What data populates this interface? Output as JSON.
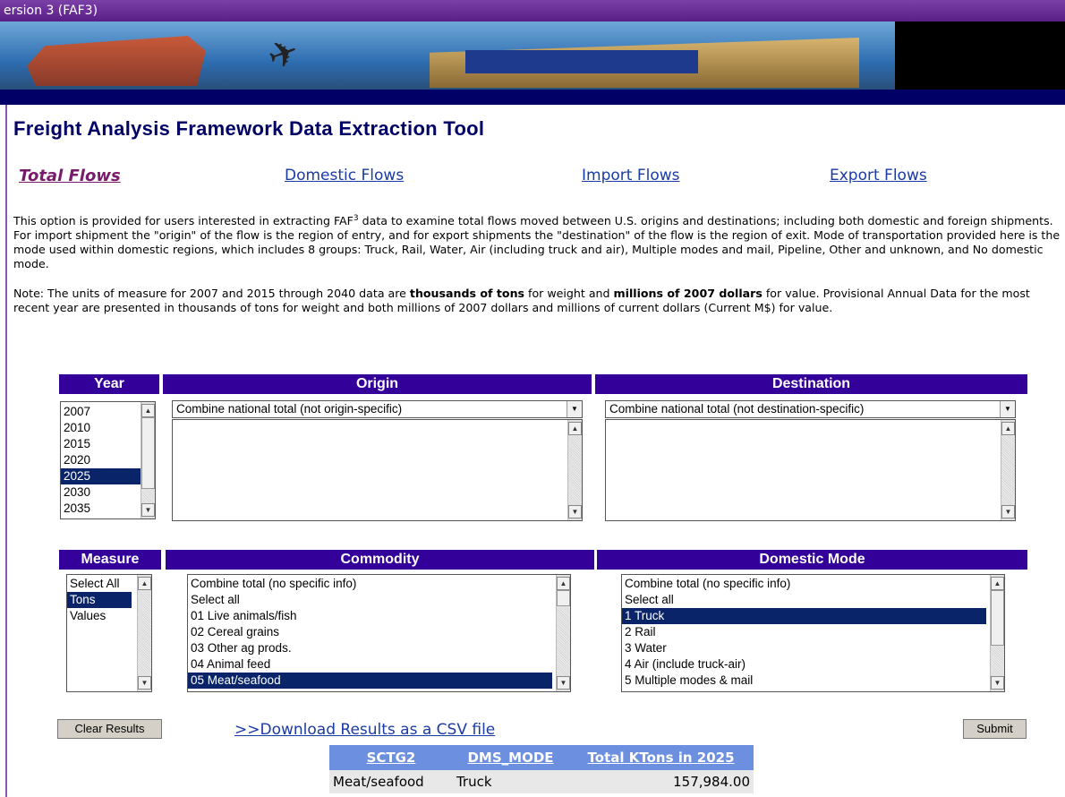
{
  "window": {
    "title": "ersion 3 (FAF3)"
  },
  "page": {
    "title": "Freight Analysis Framework Data Extraction Tool"
  },
  "tabs": [
    {
      "label": "Total Flows",
      "active": true
    },
    {
      "label": "Domestic Flows",
      "active": false
    },
    {
      "label": "Import Flows",
      "active": false
    },
    {
      "label": "Export Flows",
      "active": false
    }
  ],
  "description": {
    "p1_before": "This option is provided for users interested in extracting FAF",
    "p1_sup": "3",
    "p1_after": " data to examine total flows moved between U.S. origins and destinations; including both domestic and foreign shipments. For import shipment the \"origin\" of the flow is the region of entry, and for export shipments the \"destination\" of the flow is the region of exit. Mode of transportation provided here is the mode used within domestic regions, which includes 8 groups: Truck, Rail, Water, Air (including truck and air), Multiple modes and mail, Pipeline, Other and unknown, and No domestic mode.",
    "note_1": "Note: The units of measure for 2007 and 2015 through 2040 data are ",
    "note_bold1": "thousands of tons",
    "note_2": " for weight and ",
    "note_bold2": "millions of 2007 dollars",
    "note_3": " for value. Provisional Annual Data for the most recent year are presented in thousands of tons for weight and both millions of 2007 dollars and millions of current dollars (Current M$) for value."
  },
  "filters": {
    "year": {
      "header": "Year",
      "options": [
        "2007",
        "2010",
        "2015",
        "2020",
        "2025",
        "2030",
        "2035"
      ],
      "selected": "2025"
    },
    "origin": {
      "header": "Origin",
      "value": "Combine national total (not origin-specific)"
    },
    "destination": {
      "header": "Destination",
      "value": "Combine national total (not destination-specific)"
    },
    "measure": {
      "header": "Measure",
      "options": [
        "Select All",
        "Tons",
        "Values"
      ],
      "selected": "Tons"
    },
    "commodity": {
      "header": "Commodity",
      "options": [
        "Combine total (no specific info)",
        "Select all",
        "01 Live animals/fish",
        "02 Cereal grains",
        "03 Other ag prods.",
        "04 Animal feed",
        "05 Meat/seafood"
      ],
      "selected": "05 Meat/seafood"
    },
    "mode": {
      "header": "Domestic Mode",
      "options": [
        "Combine total (no specific info)",
        "Select all",
        "1 Truck",
        "2 Rail",
        "3 Water",
        "4 Air (include truck-air)",
        "5 Multiple modes & mail"
      ],
      "selected": "1 Truck"
    }
  },
  "actions": {
    "clear": "Clear Results",
    "download": ">>Download Results as a CSV file",
    "submit": "Submit"
  },
  "results": {
    "headers": [
      "SCTG2",
      "DMS_MODE",
      "Total KTons in 2025"
    ],
    "rows": [
      [
        "Meat/seafood",
        "Truck",
        "157,984.00"
      ]
    ]
  },
  "colors": {
    "header_bg": "#330099",
    "selection": "#0a246a",
    "title": "#000066",
    "link": "#1a3aa6",
    "active_tab": "#7a1a6a",
    "table_header": "#6c8fe0"
  }
}
